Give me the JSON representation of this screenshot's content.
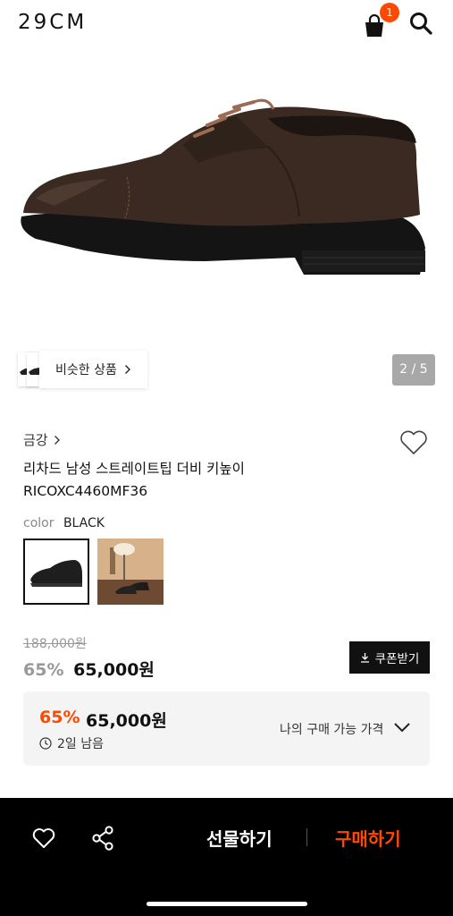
{
  "header": {
    "logo": "29CM",
    "cart_count": "1"
  },
  "gallery": {
    "similar_label": "비슷한 상품",
    "pager": "2 / 5"
  },
  "product": {
    "brand": "금강",
    "name_line1": "리차드 남성 스트레이트팁 더비 키높이",
    "name_line2": "RICOXC4460MF36",
    "color_label": "color",
    "color_value": "BLACK",
    "original_price": "188,000원",
    "discount": "65%",
    "price": "65,000원",
    "coupon_label": "쿠폰받기"
  },
  "my_price": {
    "discount": "65%",
    "price": "65,000원",
    "remaining": "2일 남음",
    "label": "나의 구매 가능 가격"
  },
  "bottom_bar": {
    "gift_label": "선물하기",
    "buy_label": "구매하기"
  },
  "colors": {
    "accent": "#ff4800",
    "dark": "#111111",
    "bar": "#000000"
  }
}
